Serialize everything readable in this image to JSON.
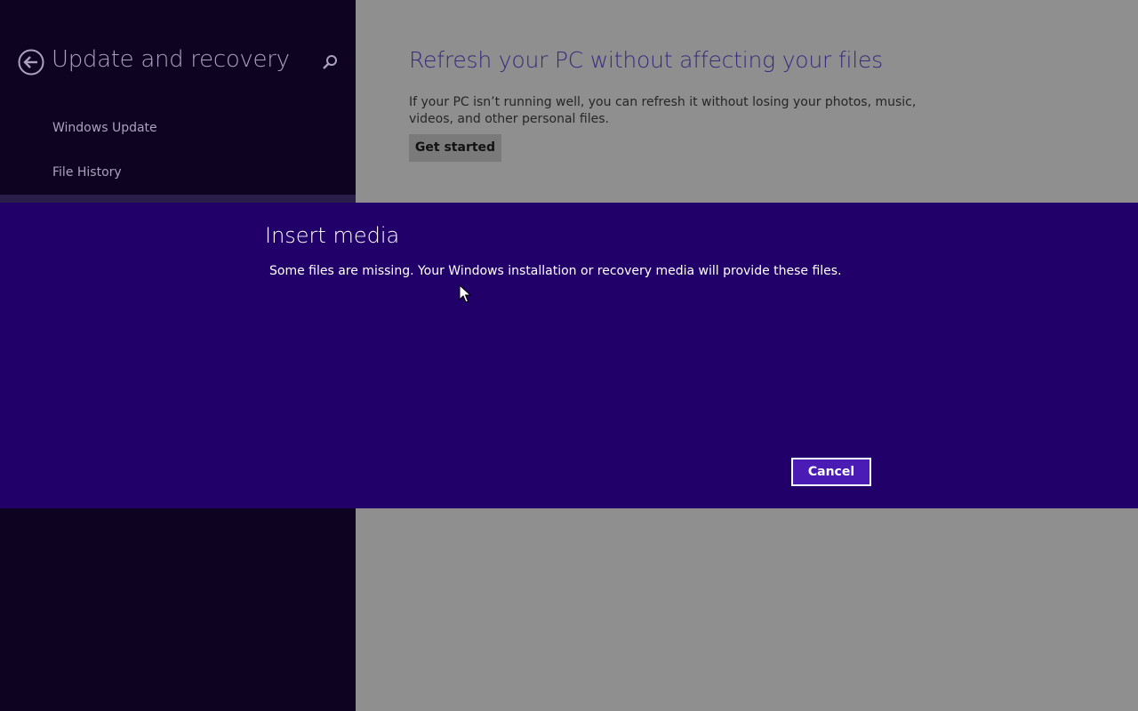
{
  "sidebar": {
    "title": "Update and recovery",
    "back_icon": "back-arrow-icon",
    "search_icon": "search-icon",
    "items": [
      {
        "label": "Windows Update"
      },
      {
        "label": "File History"
      }
    ]
  },
  "main": {
    "refresh": {
      "title": "Refresh your PC without affecting your files",
      "description": "If your PC isn’t running well, you can refresh it without losing your photos, music, videos, and other personal files.",
      "button_label": "Get started"
    }
  },
  "dialog": {
    "title": "Insert media",
    "message": "Some files are missing. Your Windows installation or recovery media will provide these files.",
    "cancel_label": "Cancel"
  },
  "colors": {
    "sidebar_bg": "#0f0322",
    "content_bg": "#8f8f8f",
    "dialog_bg": "#22006a",
    "cancel_button_bg": "#4a1bb5",
    "accent_title": "#382a7c"
  }
}
